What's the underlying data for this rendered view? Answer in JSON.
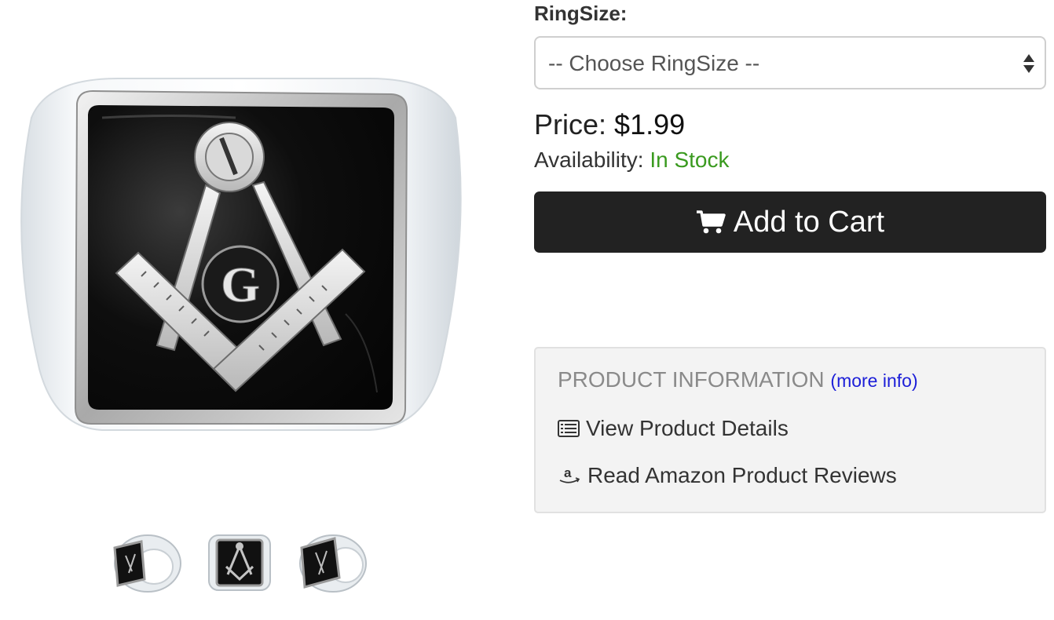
{
  "product": {
    "image_alt": "Masonic square and compass signet ring"
  },
  "gallery": {
    "thumbnails": [
      {
        "view": "angled-left"
      },
      {
        "view": "front"
      },
      {
        "view": "angled-right"
      }
    ]
  },
  "options": {
    "label": "RingSize:",
    "select_value": "-- Choose RingSize --"
  },
  "pricing": {
    "price_label": "Price:",
    "price_value": "$1.99",
    "availability_label": "Availability:",
    "availability_value": "In Stock",
    "availability_color": "#3a9a1f"
  },
  "cart": {
    "button_label": "Add to Cart",
    "icon": "shopping-cart-icon",
    "button_color": "#222222"
  },
  "info": {
    "title": "PRODUCT INFORMATION",
    "more_link": "(more info)",
    "link_color": "#1c1ed8",
    "details_link": "View Product Details",
    "details_icon": "list-icon",
    "reviews_link": "Read Amazon Product Reviews",
    "reviews_icon": "amazon-icon"
  }
}
